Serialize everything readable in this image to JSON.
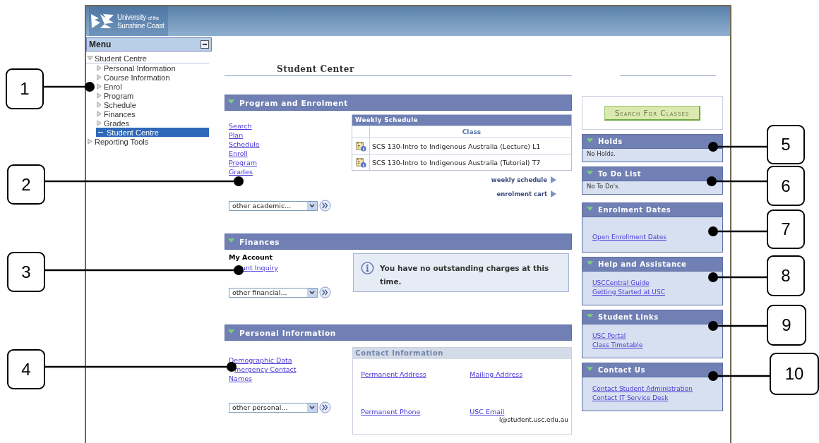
{
  "logo": {
    "line_1": "University",
    "line_1_small": "of the",
    "line_2": "Sunshine Coast"
  },
  "menu": {
    "title": "Menu",
    "items": [
      {
        "label": "Student Centre",
        "expanded": true,
        "selected": false,
        "children": [
          {
            "label": "Personal Information",
            "selected": false
          },
          {
            "label": "Course Information",
            "selected": false
          },
          {
            "label": "Enrol",
            "selected": false
          },
          {
            "label": "Program",
            "selected": false
          },
          {
            "label": "Schedule",
            "selected": false
          },
          {
            "label": "Finances",
            "selected": false
          },
          {
            "label": "Grades",
            "selected": false
          },
          {
            "label": "Student Centre",
            "selected": true
          }
        ]
      },
      {
        "label": "Reporting Tools",
        "expanded": false,
        "selected": false
      }
    ]
  },
  "page_title": "Student Center",
  "program_enrolment": {
    "title": "Program and Enrolment",
    "links": [
      "Search",
      "Plan",
      "Schedule",
      "Enroll",
      "Program",
      "Grades"
    ],
    "dropdown": "other academic...",
    "schedule": {
      "title": "Weekly Schedule",
      "column": "Class",
      "rows": [
        "SCS 130-Intro to Indigenous Australia (Lecture) L1",
        "SCS 130-Intro to Indigenous Australia (Tutorial) T7"
      ]
    },
    "more_links": [
      "weekly schedule",
      "enrolment cart"
    ]
  },
  "finances": {
    "title": "Finances",
    "heading": "My Account",
    "link": "unt Inquiry",
    "dropdown": "other financial...",
    "message": "You have no outstanding charges at this time."
  },
  "personal_information": {
    "title": "Personal Information",
    "links": [
      "Demographic Data",
      "mergency Contact",
      "Names"
    ],
    "dropdown": "other personal...",
    "contact": {
      "title": "Contact Information",
      "links": [
        "Permanent Address",
        "Mailing Address",
        "Permanent Phone",
        "USC Email"
      ],
      "email": "l@student.usc.edu.au"
    }
  },
  "search_button": "Search For Classes",
  "panels": [
    {
      "kind": "text",
      "title": "Holds",
      "text": "No Holds."
    },
    {
      "kind": "text",
      "title": "To Do List",
      "text": "No To Do's."
    },
    {
      "kind": "links",
      "title": "Enrolment Dates",
      "links": [
        "Open Enrollment Dates"
      ]
    },
    {
      "kind": "links",
      "title": "Help and Assistance",
      "links": [
        "USCCentral Guide",
        "Getting Started at USC"
      ]
    },
    {
      "kind": "links",
      "title": "Student Links",
      "links": [
        "USC Portal",
        "Class Timetable"
      ]
    },
    {
      "kind": "links",
      "title": "Contact Us",
      "links": [
        "Contact Student Administration",
        "Contact IT Service Desk"
      ]
    }
  ],
  "callouts": [
    "1",
    "2",
    "3",
    "4",
    "5",
    "6",
    "7",
    "8",
    "9",
    "10"
  ]
}
